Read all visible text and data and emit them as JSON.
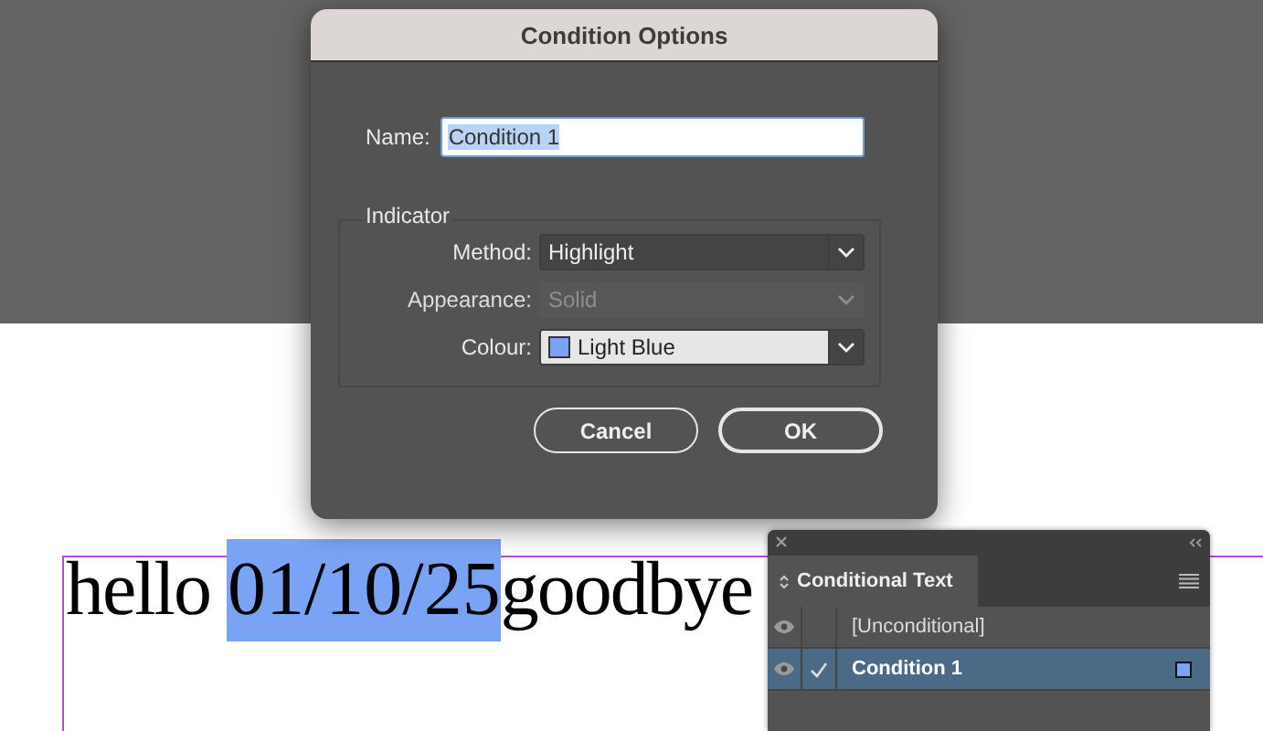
{
  "document": {
    "text_before": "hello ",
    "highlighted_text": "01/10/25",
    "highlighted": true,
    "text_after": "goodbye"
  },
  "dialog": {
    "title": "Condition Options",
    "name_label": "Name:",
    "name_value": "Condition 1",
    "name_text_selected": true,
    "group_label": "Indicator",
    "fields": [
      {
        "label": "Method:",
        "value": "Highlight",
        "disabled": false
      },
      {
        "label": "Appearance:",
        "value": "Solid",
        "disabled": true
      },
      {
        "label": "Colour:",
        "value": "Light Blue",
        "disabled": false,
        "color": "#7ba3f5"
      }
    ],
    "buttons": [
      {
        "label": "Cancel",
        "default": false
      },
      {
        "label": "OK",
        "default": true
      }
    ]
  },
  "panel": {
    "title": "Conditional Text",
    "rows": [
      {
        "label": "[Unconditional]",
        "visible": true,
        "applied": false,
        "selected": false
      },
      {
        "label": "Condition 1",
        "visible": true,
        "applied": true,
        "selected": true,
        "color": "#7ba3f5"
      }
    ]
  }
}
